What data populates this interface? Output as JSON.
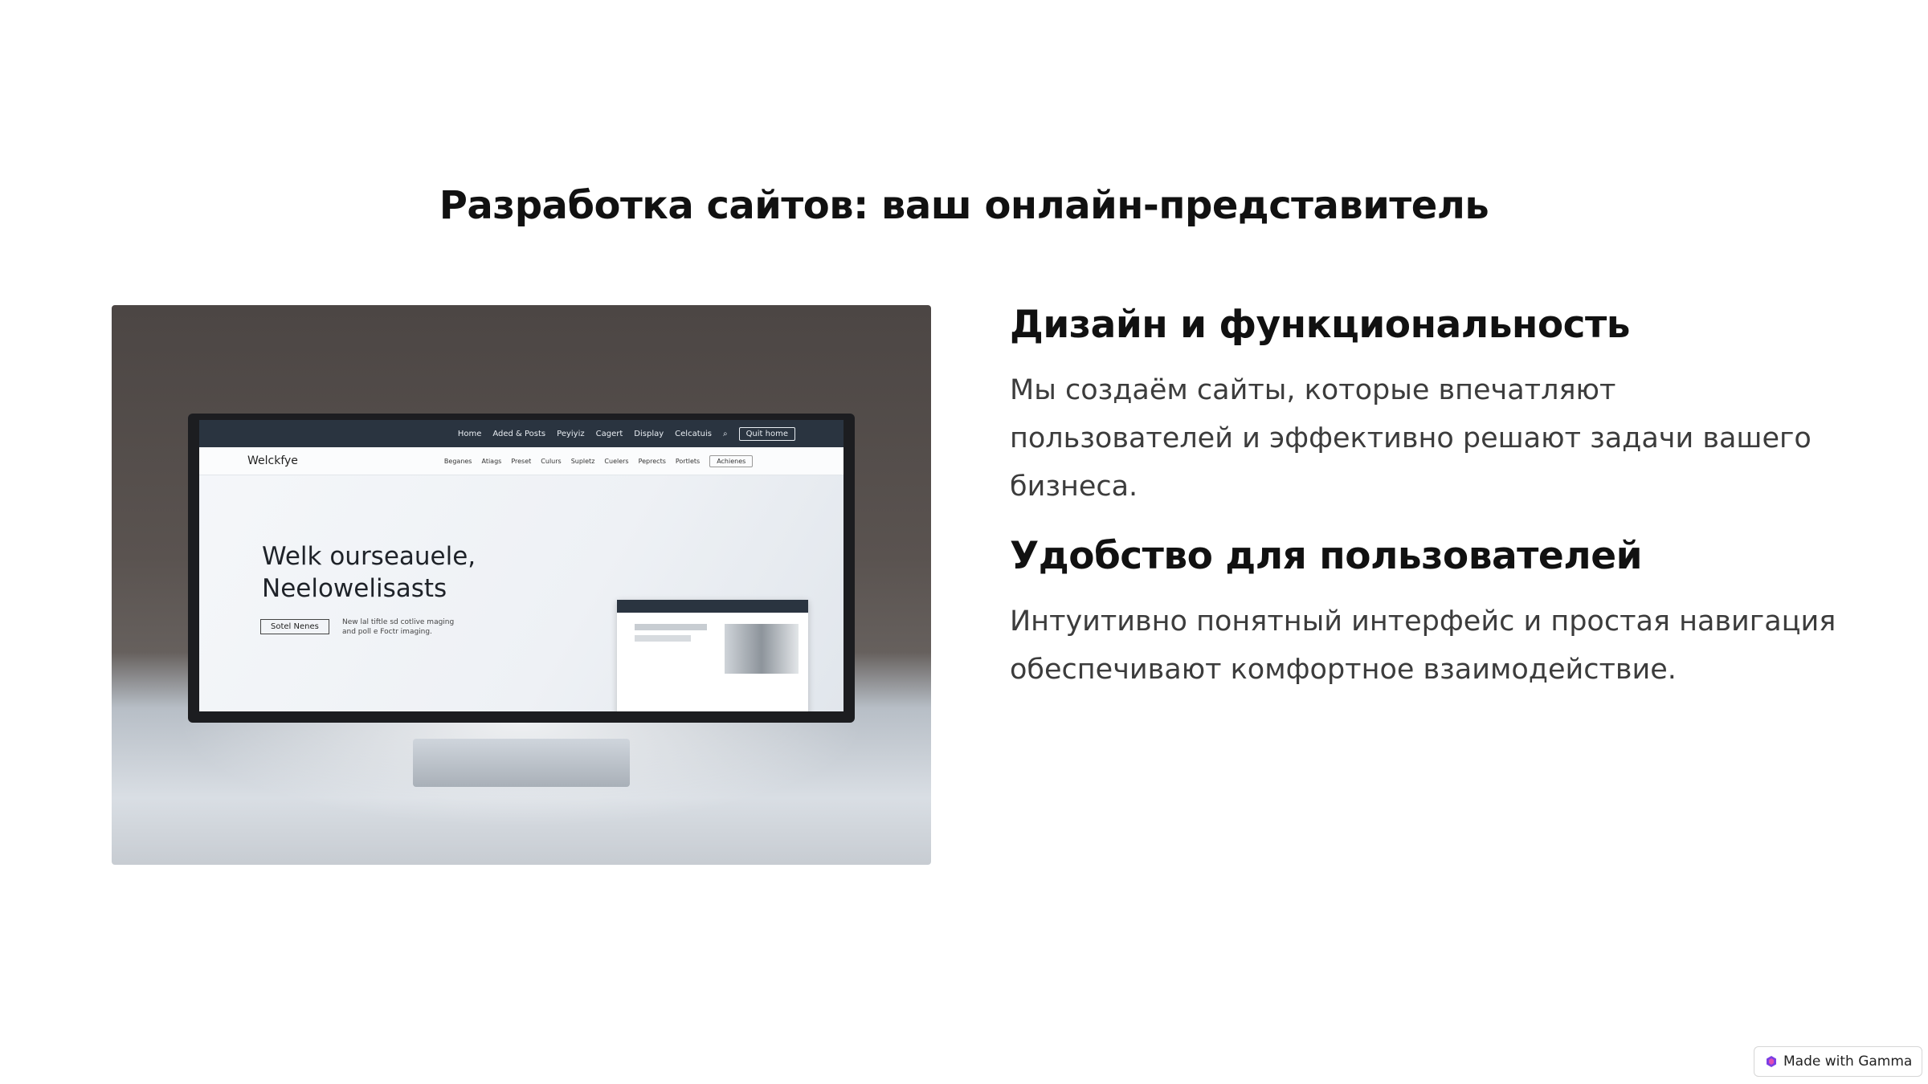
{
  "slide": {
    "title": "Разработка сайтов: ваш онлайн-представитель"
  },
  "content": {
    "sections": [
      {
        "heading": "Дизайн и функциональность",
        "body": "Мы создаём сайты, которые впечатляют пользователей и эффективно решают задачи вашего бизнеса."
      },
      {
        "heading": "Удобство для пользователей",
        "body": "Интуитивно понятный интерфейс и простая навигация обеспечивают комфортное взаимодействие."
      }
    ]
  },
  "image": {
    "topbar_items": [
      "Home",
      "Aded & Posts",
      "Peyiyiz",
      "Cagert",
      "Display",
      "Celcatuis"
    ],
    "topbar_cta": "Quit home",
    "brand": "Welckfye",
    "subbar_items": [
      "Beganes",
      "Atiags",
      "Preset",
      "Culurs",
      "Supletz",
      "Cuelers",
      "Peprects",
      "Portlets"
    ],
    "search_label": "Achienes",
    "hero_line1": "Welk ourseauele,",
    "hero_line2": "Neelowelisasts",
    "hero_button": "Sotel Nenes",
    "hero_small": "New lal tiftle sd cotlive maging and poll e Foctr imaging."
  },
  "badge": {
    "label": "Made with Gamma",
    "logo_color": "#7b3fe4"
  }
}
